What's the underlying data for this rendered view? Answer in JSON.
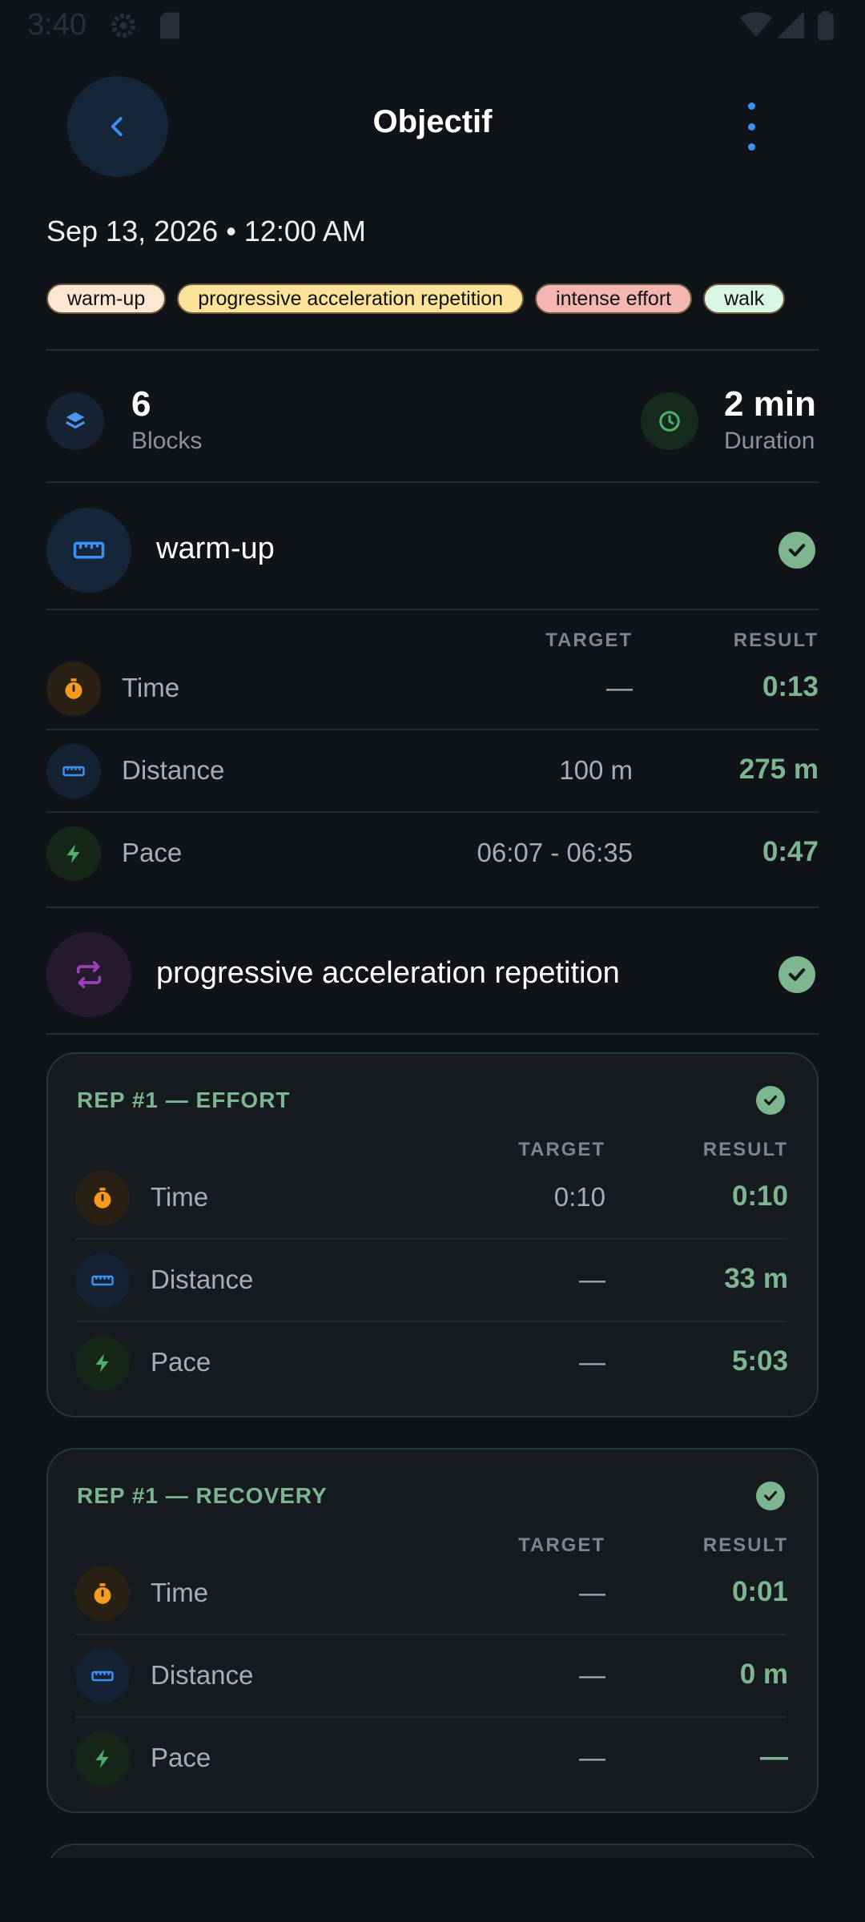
{
  "status_bar": {
    "time": "3:40"
  },
  "header": {
    "title": "Objectif"
  },
  "session": {
    "datetime": "Sep 13, 2026 • 12:00 AM"
  },
  "tags": [
    {
      "label": "warm-up",
      "color": "#fde6d2"
    },
    {
      "label": "progressive acceleration repetition",
      "color": "#fbe39a"
    },
    {
      "label": "intense effort",
      "color": "#f4b6b1"
    },
    {
      "label": "walk",
      "color": "#d9f6e3"
    }
  ],
  "summary": {
    "blocks_value": "6",
    "blocks_label": "Blocks",
    "duration_value": "2 min",
    "duration_label": "Duration"
  },
  "columns": {
    "target": "TARGET",
    "result": "RESULT"
  },
  "metric_labels": {
    "time": "Time",
    "distance": "Distance",
    "pace": "Pace"
  },
  "block_warmup": {
    "title": "warm-up",
    "time": {
      "target": "—",
      "result": "0:13"
    },
    "distance": {
      "target": "100 m",
      "result": "275 m"
    },
    "pace": {
      "target": "06:07 - 06:35",
      "result": "0:47"
    }
  },
  "block_progressive": {
    "title": "progressive acceleration repetition"
  },
  "rep_effort": {
    "title": "REP #1 — EFFORT",
    "time": {
      "target": "0:10",
      "result": "0:10"
    },
    "distance": {
      "target": "—",
      "result": "33 m"
    },
    "pace": {
      "target": "—",
      "result": "5:03"
    }
  },
  "rep_recovery": {
    "title": "REP #1 — RECOVERY",
    "time": {
      "target": "—",
      "result": "0:01"
    },
    "distance": {
      "target": "—",
      "result": "0 m"
    },
    "pace": {
      "target": "—",
      "result": "—"
    }
  },
  "colors": {
    "accent_green": "#7db590",
    "accent_blue": "#3d8ff0",
    "background": "#101419"
  }
}
